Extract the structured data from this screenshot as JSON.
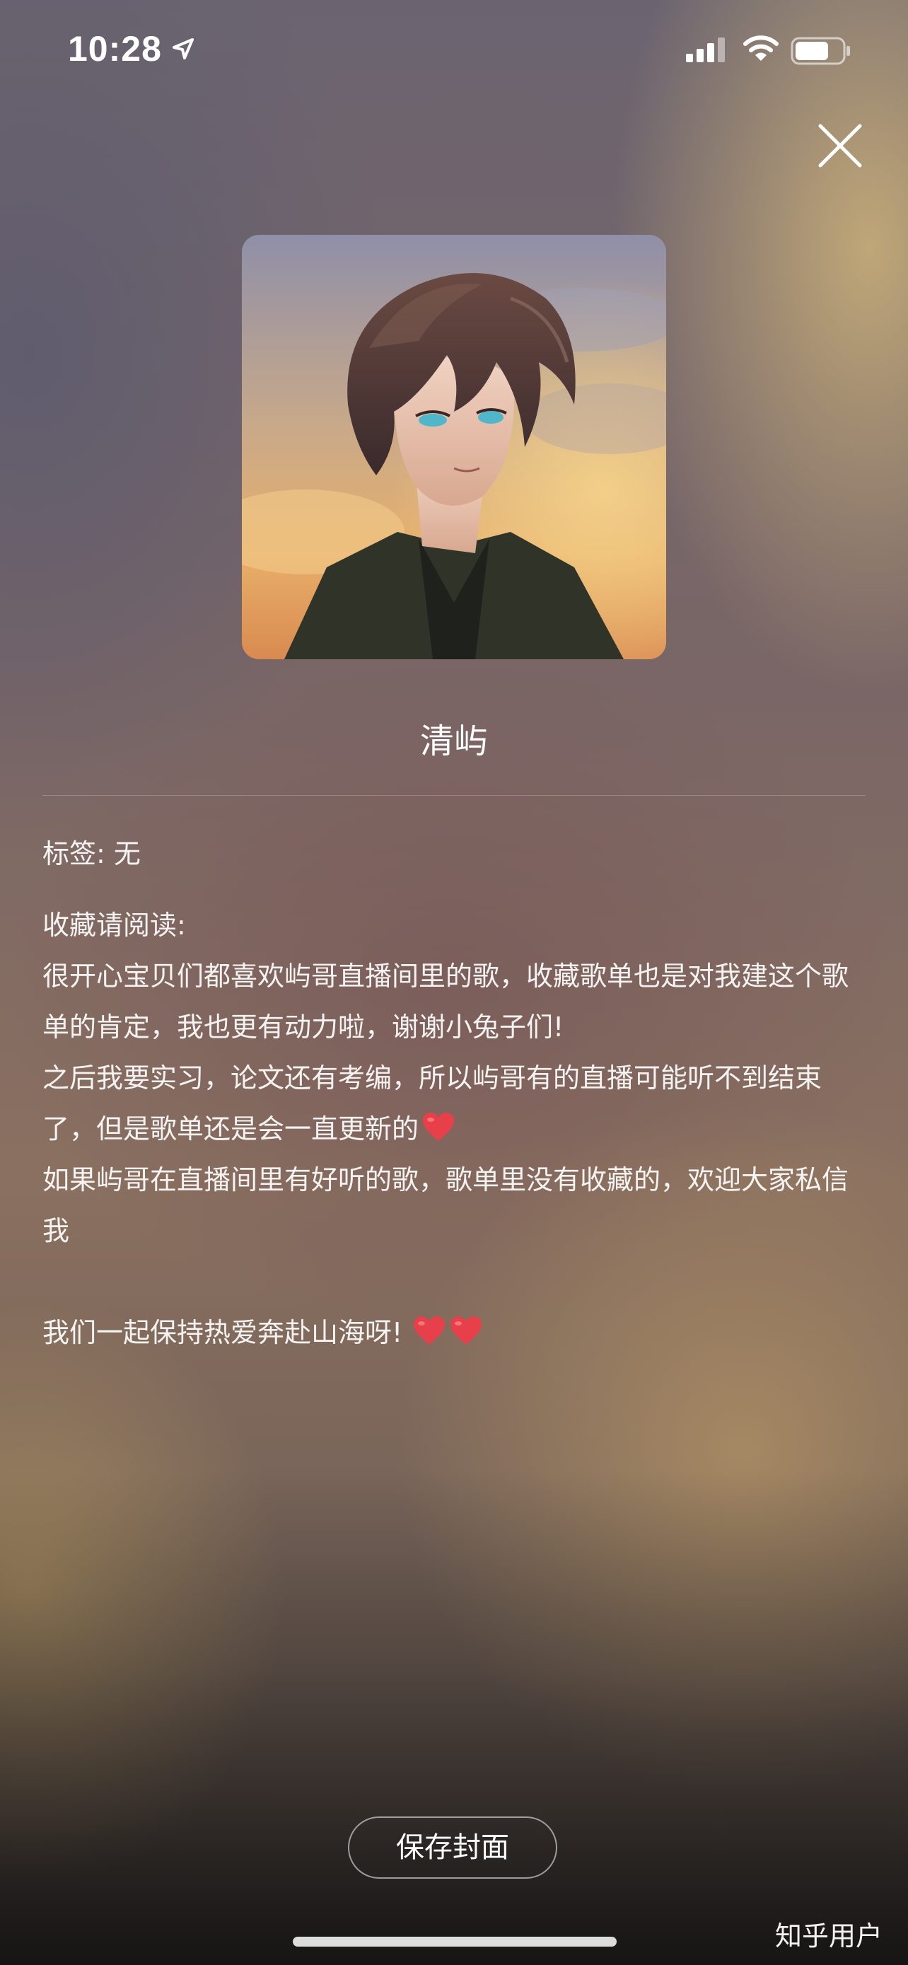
{
  "status_bar": {
    "time": "10:28",
    "location_icon": "location-arrow-icon",
    "signal_icon": "cellular-signal-icon",
    "wifi_icon": "wifi-icon",
    "battery_icon": "battery-icon"
  },
  "header": {
    "close_icon": "close-icon"
  },
  "playlist": {
    "cover_icon": "anime-portrait-cover",
    "title": "清屿",
    "tags": "标签: 无",
    "description": {
      "heading": "收藏请阅读:",
      "line1": "很开心宝贝们都喜欢屿哥直播间里的歌，收藏歌单也是对我建这个歌单的肯定，我也更有动力啦，谢谢小兔子们!",
      "line2": "之后我要实习，论文还有考编，所以屿哥有的直播可能听不到结束了，但是歌单还是会一直更新的",
      "line3": "如果屿哥在直播间里有好听的歌，歌单里没有收藏的，欢迎大家私信我",
      "line4": "我们一起保持热爱奔赴山海呀!"
    }
  },
  "actions": {
    "save_cover_label": "保存封面"
  },
  "watermark": "知乎用户",
  "colors": {
    "heart": "#e8404a",
    "text": "#ffffff"
  }
}
